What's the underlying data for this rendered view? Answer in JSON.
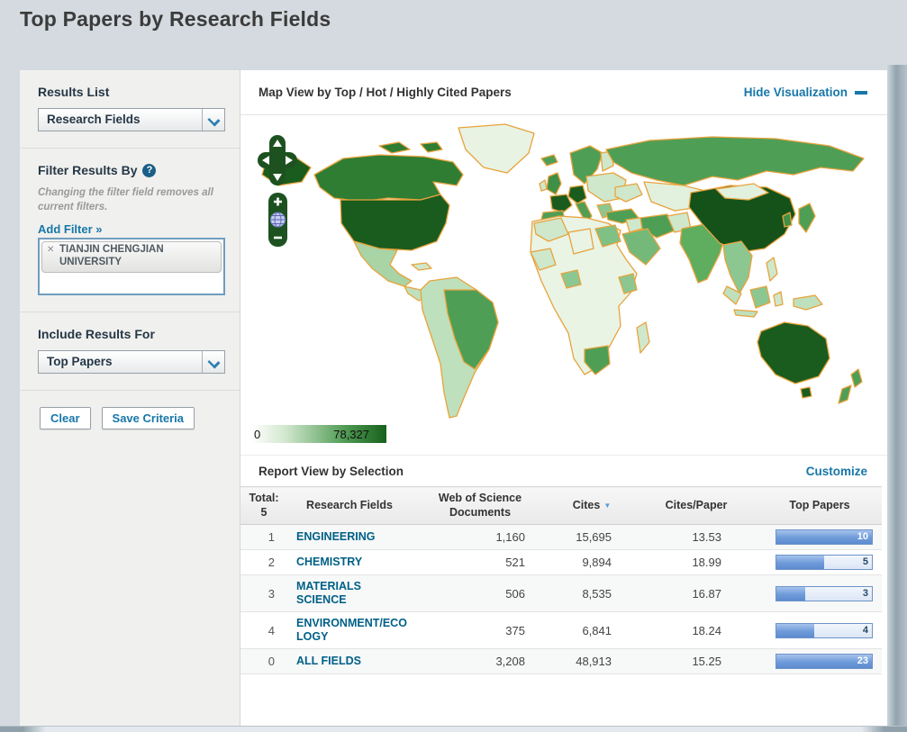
{
  "page": {
    "title": "Top Papers by Research Fields"
  },
  "colors": {
    "link": "#1777a8",
    "sort_active": "#5b9bd5",
    "map_border": "#e8a33d",
    "map_max": "#17611c"
  },
  "sidebar": {
    "results_list": {
      "label": "Results List",
      "selected": "Research Fields"
    },
    "filter": {
      "heading": "Filter Results By",
      "help_icon": "?",
      "note": "Changing the filter field removes all current filters.",
      "add_filter": "Add Filter »",
      "chips": [
        {
          "remove": "✕",
          "label": "TIANJIN CHENGJIAN UNIVERSITY"
        }
      ]
    },
    "include_results": {
      "label": "Include Results For",
      "selected": "Top Papers"
    },
    "buttons": {
      "clear": "Clear",
      "save": "Save Criteria"
    }
  },
  "map_section": {
    "title": "Map View by Top / Hot / Highly Cited Papers",
    "hide_link": "Hide Visualization",
    "legend": {
      "min": "0",
      "max": "78,327"
    },
    "controls": {
      "zoom_in": "+",
      "zoom_out": "−"
    }
  },
  "report": {
    "title": "Report View by Selection",
    "customize": "Customize",
    "total_label": "Total:",
    "total_value": "5",
    "columns": [
      "Research Fields",
      "Web of Science Documents",
      "Cites",
      "Cites/Paper",
      "Top Papers"
    ],
    "sort_arrow": "▼",
    "rows": [
      {
        "rank": "1",
        "field": "ENGINEERING",
        "wos_documents": "1,160",
        "cites": "15,695",
        "cites_per_paper": "13.53",
        "top_papers": "10",
        "bar_pct": 100
      },
      {
        "rank": "2",
        "field": "CHEMISTRY",
        "wos_documents": "521",
        "cites": "9,894",
        "cites_per_paper": "18.99",
        "top_papers": "5",
        "bar_pct": 50
      },
      {
        "rank": "3",
        "field": "MATERIALS SCIENCE",
        "wos_documents": "506",
        "cites": "8,535",
        "cites_per_paper": "16.87",
        "top_papers": "3",
        "bar_pct": 30
      },
      {
        "rank": "4",
        "field": "ENVIRONMENT/ECOLOGY",
        "wos_documents": "375",
        "cites": "6,841",
        "cites_per_paper": "18.24",
        "top_papers": "4",
        "bar_pct": 40
      },
      {
        "rank": "0",
        "field": "ALL FIELDS",
        "wos_documents": "3,208",
        "cites": "48,913",
        "cites_per_paper": "15.25",
        "top_papers": "23",
        "bar_pct": 100
      }
    ]
  }
}
